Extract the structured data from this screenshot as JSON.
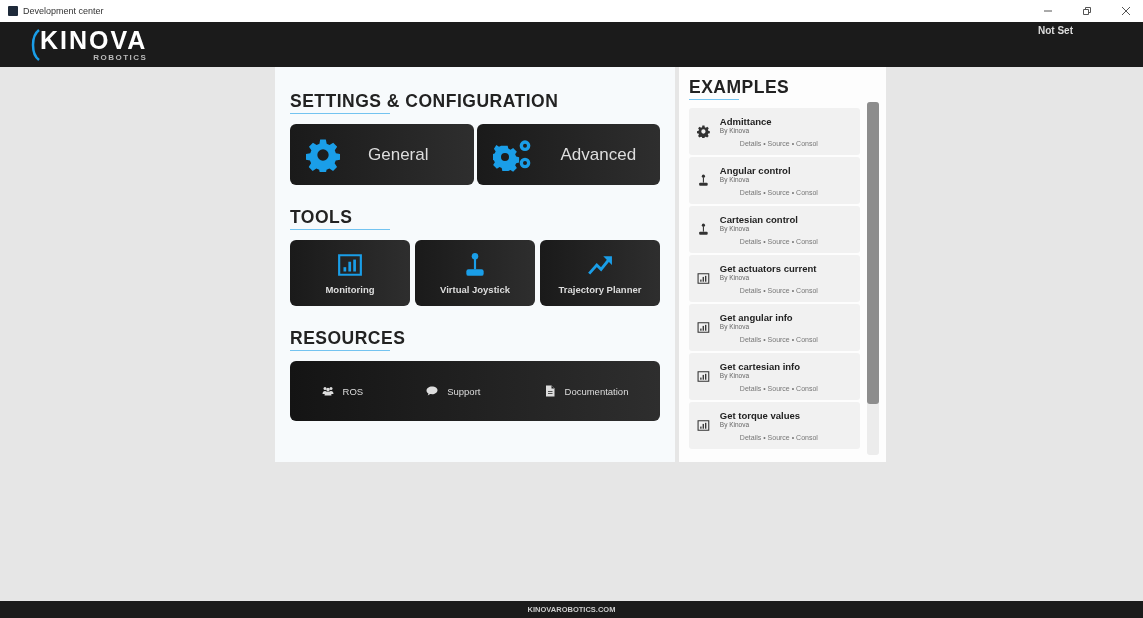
{
  "window": {
    "title": "Development center"
  },
  "header": {
    "logo": "KINOVA",
    "logo_sub": "ROBOTICS",
    "user": "Not Set"
  },
  "sections": [
    {
      "title": "SETTINGS & CONFIGURATION",
      "kind": "large",
      "buttons": [
        {
          "label": "General",
          "kind": "gear"
        },
        {
          "label": "Advanced",
          "kind": "gears"
        }
      ]
    },
    {
      "title": "TOOLS",
      "kind": "tiles",
      "buttons": [
        {
          "label": "Monitoring",
          "kind": "chart"
        },
        {
          "label": "Virtual Joystick",
          "kind": "joystick"
        },
        {
          "label": "Trajectory Planner",
          "kind": "trend"
        }
      ]
    },
    {
      "title": "RESOURCES",
      "kind": "bar",
      "buttons": [
        {
          "label": "ROS",
          "kind": "people"
        },
        {
          "label": "Support",
          "kind": "chat"
        },
        {
          "label": "Documentation",
          "kind": "doc"
        }
      ]
    }
  ],
  "examples": {
    "title": "EXAMPLES",
    "items": [
      {
        "name": "Admittance",
        "author": "By Kinova",
        "kind": "gear",
        "links": "Details • Source • Consol"
      },
      {
        "name": "Angular control",
        "author": "By Kinova",
        "kind": "joystick",
        "links": "Details • Source • Consol"
      },
      {
        "name": "Cartesian control",
        "author": "By Kinova",
        "kind": "joystick",
        "links": "Details • Source • Consol"
      },
      {
        "name": "Get actuators current",
        "author": "By Kinova",
        "kind": "chart",
        "links": "Details • Source • Consol"
      },
      {
        "name": "Get angular info",
        "author": "By Kinova",
        "kind": "chart",
        "links": "Details • Source • Consol"
      },
      {
        "name": "Get cartesian info",
        "author": "By Kinova",
        "kind": "chart",
        "links": "Details • Source • Consol"
      },
      {
        "name": "Get torque values",
        "author": "By Kinova",
        "kind": "chart",
        "links": "Details • Source • Consol"
      }
    ]
  },
  "footer": {
    "text": "KINOVAROBOTICS.COM"
  }
}
